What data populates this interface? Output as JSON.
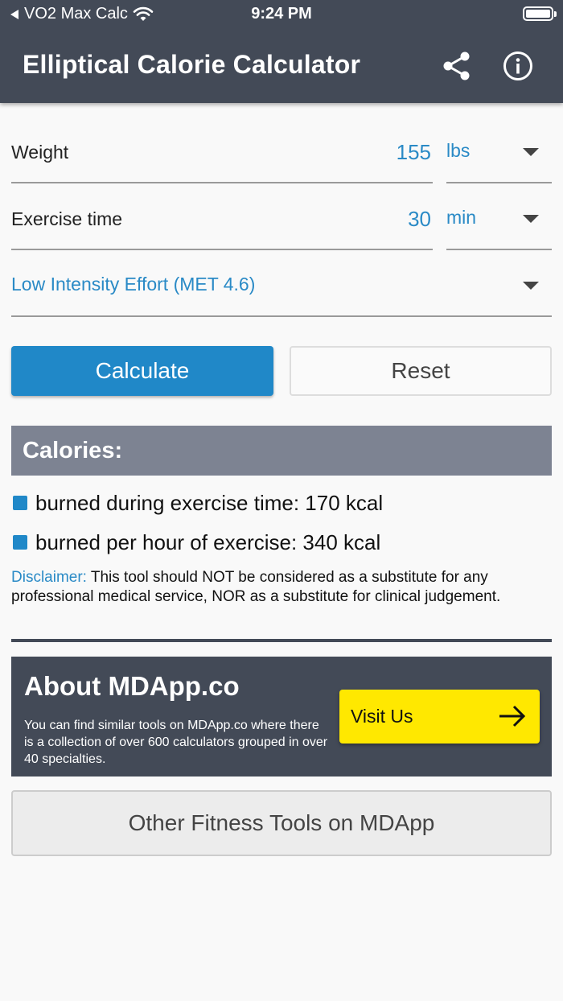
{
  "status_bar": {
    "back_app": "VO2 Max Calc",
    "time": "9:24 PM"
  },
  "header": {
    "title": "Elliptical Calorie Calculator",
    "share_icon": "share-icon",
    "info_icon": "info-icon"
  },
  "form": {
    "weight": {
      "label": "Weight",
      "value": "155",
      "unit": "lbs"
    },
    "exercise_time": {
      "label": "Exercise time",
      "value": "30",
      "unit": "min"
    },
    "intensity": {
      "selected": "Low Intensity Effort (MET 4.6)"
    }
  },
  "buttons": {
    "calculate": "Calculate",
    "reset": "Reset"
  },
  "results": {
    "header": "Calories:",
    "items": [
      "burned during exercise time: 170 kcal",
      "burned per hour of exercise: 340 kcal"
    ]
  },
  "disclaimer": {
    "label": "Disclaimer:",
    "text": " This tool should NOT be considered as a substitute for any professional medical service, NOR as a substitute for clinical judgement."
  },
  "about": {
    "title": "About MDApp.co",
    "text": "You can find similar tools on MDApp.co where there is a collection of over 600 calculators grouped in over 40 specialties.",
    "visit_label": "Visit Us"
  },
  "other_tools": "Other Fitness Tools on MDApp",
  "colors": {
    "header_bg": "#434a57",
    "accent_blue": "#2088c8",
    "results_header_bg": "#7d8392",
    "visit_yellow": "#ffe800"
  }
}
